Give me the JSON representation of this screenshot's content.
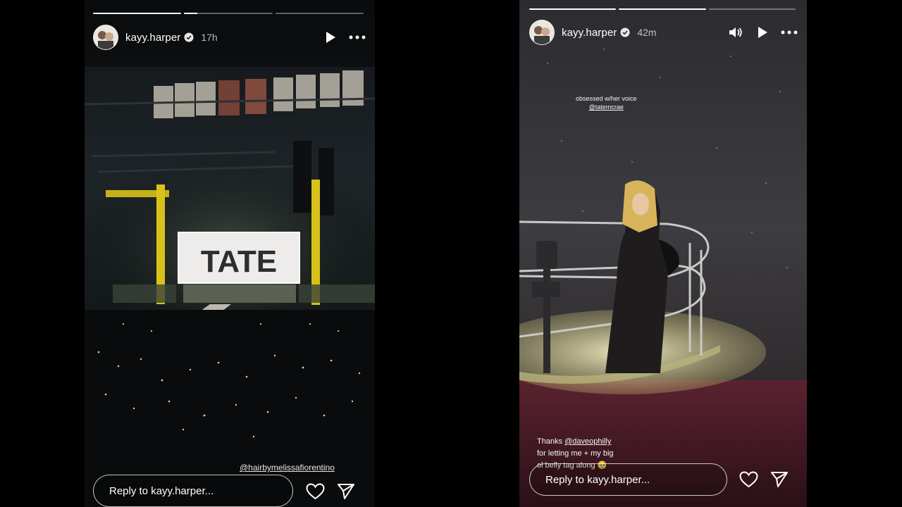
{
  "stories": [
    {
      "username": "kayy.harper",
      "time": "17h",
      "progress": [
        1.0,
        0.15,
        0.0
      ],
      "screen_text": "TATE",
      "mention": "@hairbymelissafiorentino",
      "reply_placeholder": "Reply to kayy.harper...",
      "icons": {
        "verified": "verified-badge-icon",
        "play": "play-icon",
        "more": "more-horizontal-icon",
        "like": "heart-icon",
        "share": "send-icon"
      }
    },
    {
      "username": "kayy.harper",
      "time": "42m",
      "progress": [
        1.0,
        1.0,
        0.0
      ],
      "caption_top_line1": "obsessed w/her voice",
      "caption_top_line2": "@tatemcrae",
      "caption_bottom_line1_prefix": "Thanks ",
      "caption_bottom_line1_mention": "@daveophilly",
      "caption_bottom_line2": "for letting me + my big",
      "caption_bottom_line3": "ol belly tag along",
      "caption_bottom_emoji": "🥹",
      "reply_placeholder": "Reply to kayy.harper...",
      "icons": {
        "verified": "verified-badge-icon",
        "sound": "speaker-icon",
        "play": "play-icon",
        "more": "more-horizontal-icon",
        "like": "heart-icon",
        "share": "send-icon"
      }
    }
  ],
  "colors": {
    "background": "#000000",
    "truss_yellow": "#d8c21a",
    "stage_light": "#f1eaa8",
    "stage_red": "#a3242f"
  }
}
